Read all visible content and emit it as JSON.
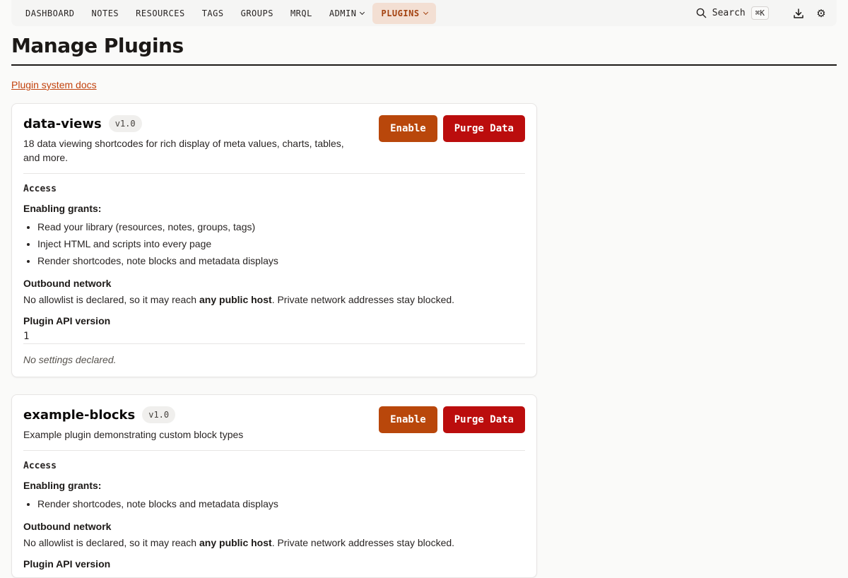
{
  "nav": {
    "items": [
      {
        "label": "DASHBOARD"
      },
      {
        "label": "NOTES"
      },
      {
        "label": "RESOURCES"
      },
      {
        "label": "TAGS"
      },
      {
        "label": "GROUPS"
      },
      {
        "label": "MRQL"
      },
      {
        "label": "ADMIN"
      },
      {
        "label": "PLUGINS"
      }
    ],
    "search_label": "Search",
    "search_shortcut": "⌘K",
    "download_icon": "download-icon",
    "settings_icon": "gear-icon"
  },
  "page": {
    "title": "Manage Plugins",
    "docs_link": "Plugin system docs"
  },
  "labels": {
    "access": "Access",
    "enabling_grants": "Enabling grants:",
    "outbound_network": "Outbound network",
    "network_pre": "No allowlist is declared, so it may reach ",
    "network_bold": "any public host",
    "network_post": ". Private network addresses stay blocked.",
    "plugin_api_version": "Plugin API version",
    "no_settings": "No settings declared.",
    "enable": "Enable",
    "purge": "Purge Data"
  },
  "plugins": [
    {
      "name": "data-views",
      "version": "v1.0",
      "description": "18 data viewing shortcodes for rich display of meta values, charts, tables, and more.",
      "grants": [
        "Read your library (resources, notes, groups, tags)",
        "Inject HTML and scripts into every page",
        "Render shortcodes, note blocks and metadata displays"
      ],
      "api_version": "1"
    },
    {
      "name": "example-blocks",
      "version": "v1.0",
      "description": "Example plugin demonstrating custom block types",
      "grants": [
        "Render shortcodes, note blocks and metadata displays"
      ],
      "plugin_api_version_label": "Plugin API version"
    }
  ],
  "colors": {
    "accent": "#b9470b",
    "danger": "#bb0d0d",
    "active_nav_bg": "#f3dfd3"
  }
}
